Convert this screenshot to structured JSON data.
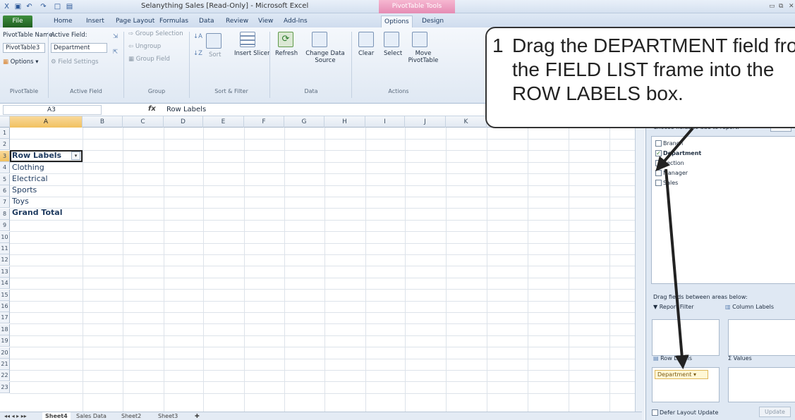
{
  "window": {
    "title": "Selanything Sales  [Read-Only]  -  Microsoft Excel",
    "contextual_tab": "PivotTable Tools"
  },
  "ribbon_tabs": [
    "File",
    "Home",
    "Insert",
    "Page Layout",
    "Formulas",
    "Data",
    "Review",
    "View",
    "Add-Ins",
    "Options",
    "Design"
  ],
  "ribbon": {
    "pivot_name_label": "PivotTable Name:",
    "pivot_name_value": "PivotTable3",
    "options_label": "Options",
    "pivottable_group": "PivotTable",
    "active_field_label": "Active Field:",
    "active_field_value": "Department",
    "field_settings": "Field Settings",
    "active_field_group": "Active Field",
    "group_selection": "Group Selection",
    "ungroup": "Ungroup",
    "group_field": "Group Field",
    "group_group": "Group",
    "sort": "Sort",
    "insert_slicer": "Insert Slicer",
    "sort_filter_group": "Sort & Filter",
    "refresh": "Refresh",
    "change_data_source": "Change Data Source",
    "data_group": "Data",
    "clear": "Clear",
    "select": "Select",
    "move_pivottable": "Move PivotTable",
    "actions_group": "Actions"
  },
  "formula_bar": {
    "cell_ref": "A3",
    "fx": "fx",
    "formula": "Row Labels"
  },
  "grid": {
    "columns": [
      "A",
      "B",
      "C",
      "D",
      "E",
      "F",
      "G",
      "H",
      "I",
      "J",
      "K"
    ],
    "rows": [
      "1",
      "2",
      "3",
      "4",
      "5",
      "6",
      "7",
      "8",
      "9",
      "10",
      "11",
      "12",
      "13",
      "14",
      "15",
      "16",
      "17",
      "18",
      "19",
      "20",
      "21",
      "22",
      "23"
    ],
    "cells": {
      "a3": "Row Labels",
      "a4": "Clothing",
      "a5": "Electrical",
      "a6": "Sports",
      "a7": "Toys",
      "a8": "Grand Total"
    }
  },
  "sheet_tabs": [
    "Sheet4",
    "Sales Data",
    "Sheet2",
    "Sheet3"
  ],
  "field_list": {
    "choose_label": "Choose fields to add to report:",
    "fields": [
      {
        "label": "Branch",
        "checked": false
      },
      {
        "label": "Department",
        "checked": true
      },
      {
        "label": "Section",
        "checked": false
      },
      {
        "label": "Manager",
        "checked": false
      },
      {
        "label": "Sales",
        "checked": false
      }
    ],
    "drag_label": "Drag fields between areas below:",
    "report_filter": "Report Filter",
    "column_labels": "Column Labels",
    "row_labels": "Row Labels",
    "values": "Values",
    "row_field_chip": "Department",
    "defer_label": "Defer Layout Update",
    "update_button": "Update"
  },
  "callout": {
    "number": "1",
    "text": "Drag the DEPARTMENT field from the FIELD LIST frame into the ROW LABELS box."
  }
}
